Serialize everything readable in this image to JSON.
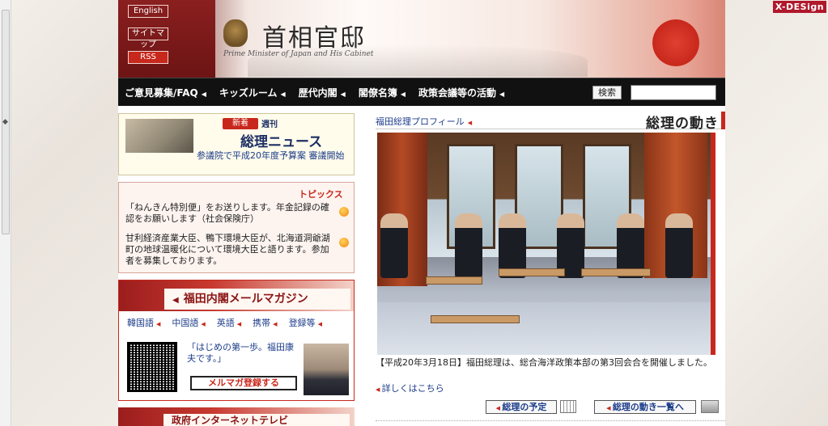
{
  "badge": {
    "label": "X-DESign"
  },
  "header": {
    "english": "English",
    "sitemap": "サイトマップ",
    "rss": "RSS",
    "title": "首相官邸",
    "subtitle": "Prime Minister of Japan and His Cabinet"
  },
  "nav": {
    "items": [
      "ご意見募集/FAQ",
      "キッズルーム",
      "歴代内閣",
      "閣僚名簿",
      "政策会議等の活動"
    ],
    "search_label": "検索",
    "search_placeholder": ""
  },
  "news": {
    "weekly": "週刊",
    "new_badge": "新着",
    "title": "総理ニュース",
    "link": "参議院で平成20年度予算案 審議開始"
  },
  "topics": {
    "title": "トピックス",
    "items": [
      {
        "text": "「ねんきん特別便」をお送りします。年金記録の確認をお願いします（社会保険庁）",
        "link": "ねんきん特別便"
      },
      {
        "text": "甘利経済産業大臣、鴨下環境大臣が、北海道洞爺湖町の地球温暖化について環境大臣と語ります。参加者を募集しております。",
        "link": "参加者を募集しております。"
      }
    ]
  },
  "mail": {
    "title": "福田内閣メールマガジン",
    "langs": [
      "韓国語",
      "中国語",
      "英語",
      "携帯",
      "登録等"
    ],
    "message": "「はじめの第一歩。福田康夫です。」",
    "register": "メルマガ登録する"
  },
  "bottom_box": {
    "title": "政府インターネットテレビ"
  },
  "main": {
    "section_title": "総理の動き",
    "profile_link": "福田総理プロフィール",
    "caption": "【平成20年3月18日】福田総理は、総合海洋政策本部の第3回会合を開催しました。",
    "details": "詳しくはこちら",
    "schedule_button": "総理の予定",
    "list_button": "総理の動き一覧へ"
  }
}
